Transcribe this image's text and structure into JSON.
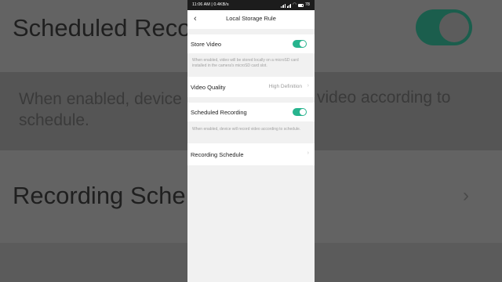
{
  "background": {
    "scheduled_title": "Scheduled Recor",
    "scheduled_desc_a": "When enabled, device",
    "scheduled_desc_b": "schedule.",
    "scheduled_desc_c": "video according to",
    "schedule_title": "Recording Sche"
  },
  "status_bar": {
    "time_info": "11:06 AM | 0.4KB/s",
    "battery_level": "78"
  },
  "nav": {
    "back_icon": "chevron-left",
    "title": "Local Storage Rule"
  },
  "settings": {
    "store_video": {
      "label": "Store Video",
      "enabled": true,
      "description": "When enabled, video will be stored locally on a microSD card installed in the camera's microSD card slot."
    },
    "video_quality": {
      "label": "Video Quality",
      "value": "High Definition"
    },
    "scheduled_recording": {
      "label": "Scheduled Recording",
      "enabled": true,
      "description": "When enabled, device will record video according to schedule."
    },
    "recording_schedule": {
      "label": "Recording Schedule"
    }
  },
  "colors": {
    "accent": "#27b48e",
    "background": "#f1f1f1"
  }
}
